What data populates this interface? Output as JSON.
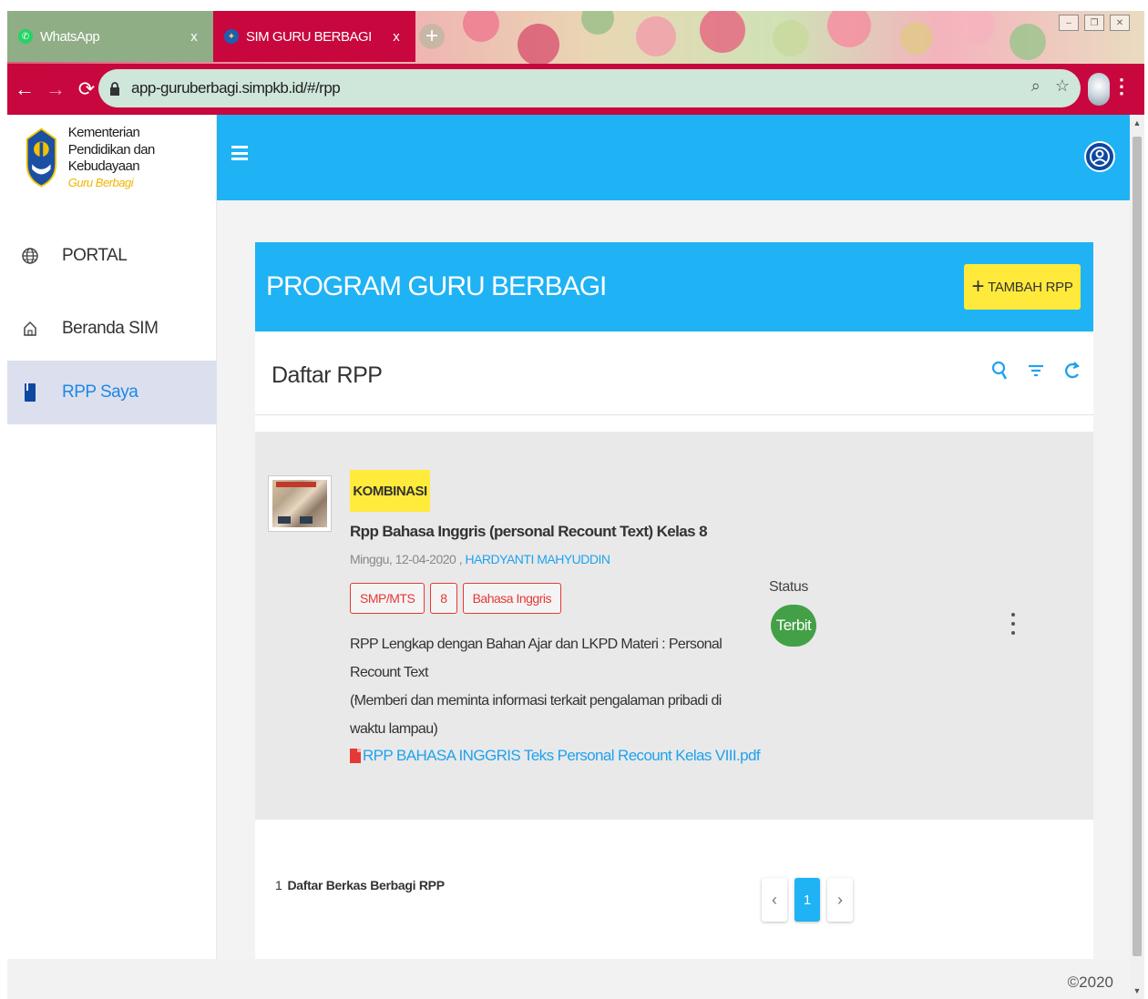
{
  "browser": {
    "tabs": [
      {
        "label": "WhatsApp",
        "close": "x"
      },
      {
        "label": "SIM GURU BERBAGI",
        "close": "x"
      }
    ],
    "url": "app-guruberbagi.simpkb.id/#/rpp"
  },
  "sidebar": {
    "brand_line1": "Kementerian",
    "brand_line2": "Pendidikan dan Kebudayaan",
    "brand_sub": "Guru Berbagi",
    "items": [
      {
        "label": "PORTAL",
        "icon": "globe-icon"
      },
      {
        "label": "Beranda SIM",
        "icon": "home-icon"
      },
      {
        "label": "RPP Saya",
        "icon": "book-icon",
        "active": true
      }
    ]
  },
  "header": {
    "title": "PROGRAM GURU BERBAGI",
    "add_button": "TAMBAH RPP"
  },
  "list": {
    "title": "Daftar RPP",
    "items": [
      {
        "badge": "KOMBINASI",
        "title": "Rpp Bahasa Inggris (personal Recount Text) Kelas 8",
        "date": "Minggu, 12-04-2020",
        "author": "HARDYANTI MAHYUDDIN",
        "chips": [
          "SMP/MTS",
          "8",
          "Bahasa Inggris"
        ],
        "desc_line1": "RPP Lengkap dengan Bahan Ajar dan LKPD Materi : Personal Recount Text",
        "desc_line2": "(Memberi dan meminta informasi terkait pengalaman pribadi di waktu lampau)",
        "more": "...",
        "file": "RPP BAHASA INGGRIS Teks Personal Recount Kelas VIII.pdf",
        "status_label": "Status",
        "status": "Terbit"
      }
    ],
    "count_num": "1",
    "count_text": "Daftar Berkas Berbagi RPP",
    "pagination": {
      "prev": "‹",
      "current": "1",
      "next": "›"
    }
  },
  "footer": {
    "copyright": "©2020"
  },
  "colors": {
    "tab_active": "#c7073d",
    "primary": "#1fb2f5",
    "accent_button": "#ffea3b",
    "status_green": "#43a047",
    "chip_red": "#e53935"
  }
}
